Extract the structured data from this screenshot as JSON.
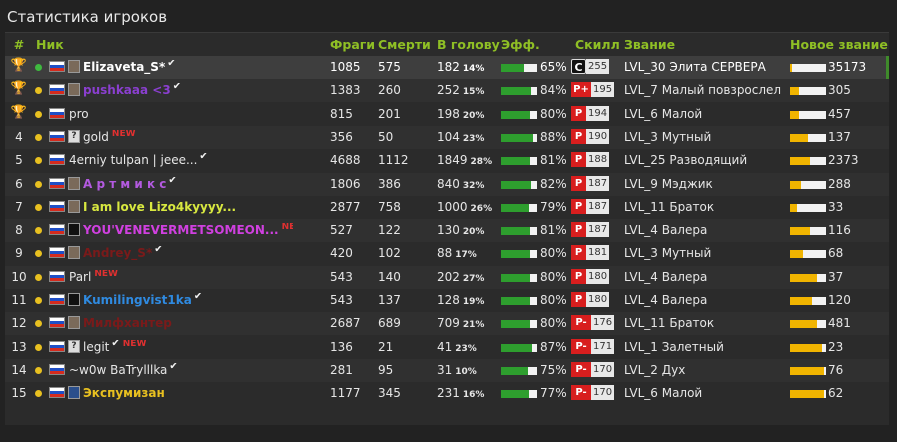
{
  "title": "Статистика игроков",
  "colors": {
    "header": "#8fbf25",
    "accent_green": "#2e9e2e",
    "rank_yellow": "#f0b400",
    "skill_red": "#d81e1e"
  },
  "headers": {
    "num": "#",
    "nick": "Ник",
    "frags": "Фраги",
    "deaths": "Смерти",
    "headshots": "В голову",
    "eff": "Эфф.",
    "skill": "Скилл",
    "rank": "Звание",
    "new_rank": "Новое звание"
  },
  "rows": [
    {
      "num": "",
      "trophy": "gold",
      "dot": "#3fb93f",
      "avatar": "photo",
      "nick": "Elizaveta_S*",
      "nick_color": "#ffffff",
      "verified": true,
      "new": "",
      "frags": "1085",
      "deaths": "575",
      "hs": "182",
      "hs_pct": "14%",
      "eff": 0.65,
      "eff_label": "65%",
      "skill_grade": "C",
      "skill": "255",
      "rank": "LVL_30 Элита СЕРВЕРА",
      "new_rank": 0.05,
      "new_rank_value": "35173"
    },
    {
      "num": "",
      "trophy": "silver",
      "dot": "#e8c020",
      "avatar": "photo",
      "nick": "pushkaaa <3",
      "nick_color": "#8a3fcf",
      "verified": true,
      "new": "",
      "frags": "1383",
      "deaths": "260",
      "hs": "252",
      "hs_pct": "15%",
      "eff": 0.84,
      "eff_label": "84%",
      "skill_grade": "P+",
      "skill": "195",
      "rank": "LVL_7 Малый повзрослел",
      "new_rank": 0.25,
      "new_rank_value": "305"
    },
    {
      "num": "",
      "trophy": "bronze",
      "dot": "#e8c020",
      "avatar": "none",
      "nick": "pro",
      "nick_color": "#e6e6e6",
      "verified": false,
      "new": "",
      "frags": "815",
      "deaths": "201",
      "hs": "198",
      "hs_pct": "20%",
      "eff": 0.8,
      "eff_label": "80%",
      "skill_grade": "P",
      "skill": "194",
      "rank": "LVL_6 Малой",
      "new_rank": 0.25,
      "new_rank_value": "457"
    },
    {
      "num": "4",
      "trophy": "",
      "dot": "#e8c020",
      "avatar": "q",
      "nick": "gold",
      "nick_color": "#e6e6e6",
      "verified": false,
      "new": "NEW",
      "frags": "356",
      "deaths": "50",
      "hs": "104",
      "hs_pct": "23%",
      "eff": 0.88,
      "eff_label": "88%",
      "skill_grade": "P",
      "skill": "190",
      "rank": "LVL_3 Мутный",
      "new_rank": 0.5,
      "new_rank_value": "137"
    },
    {
      "num": "5",
      "trophy": "",
      "dot": "#e8c020",
      "avatar": "none",
      "nick": "4erniy tulpan | jeee...",
      "nick_color": "#e6e6e6",
      "verified": true,
      "new": "",
      "frags": "4688",
      "deaths": "1112",
      "hs": "1849",
      "hs_pct": "28%",
      "eff": 0.81,
      "eff_label": "81%",
      "skill_grade": "P",
      "skill": "188",
      "rank": "LVL_25 Разводящий",
      "new_rank": 0.55,
      "new_rank_value": "2373"
    },
    {
      "num": "6",
      "trophy": "",
      "dot": "#e8c020",
      "avatar": "photo",
      "nick": "А р т м и к с",
      "nick_color": "#b35ae0",
      "verified": true,
      "new": "",
      "frags": "1806",
      "deaths": "386",
      "hs": "840",
      "hs_pct": "32%",
      "eff": 0.82,
      "eff_label": "82%",
      "skill_grade": "P",
      "skill": "187",
      "rank": "LVL_9 Мэджик",
      "new_rank": 0.3,
      "new_rank_value": "288"
    },
    {
      "num": "7",
      "trophy": "",
      "dot": "#e8c020",
      "avatar": "photo",
      "nick": "I am love Lizo4kyyyy...",
      "nick_color": "#d8e840",
      "verified": false,
      "new": "",
      "frags": "2877",
      "deaths": "758",
      "hs": "1000",
      "hs_pct": "26%",
      "eff": 0.79,
      "eff_label": "79%",
      "skill_grade": "P",
      "skill": "187",
      "rank": "LVL_11 Браток",
      "new_rank": 0.2,
      "new_rank_value": "33"
    },
    {
      "num": "8",
      "trophy": "",
      "dot": "#e8c020",
      "avatar": "dark",
      "nick": "YOU'VENEVERMETSOMEON...",
      "nick_color": "#d040e0",
      "verified": false,
      "new": "NEW",
      "frags": "527",
      "deaths": "122",
      "hs": "130",
      "hs_pct": "20%",
      "eff": 0.81,
      "eff_label": "81%",
      "skill_grade": "P",
      "skill": "187",
      "rank": "LVL_4 Валера",
      "new_rank": 0.55,
      "new_rank_value": "116"
    },
    {
      "num": "9",
      "trophy": "",
      "dot": "#e8c020",
      "avatar": "photo",
      "nick": "Andrey_S*",
      "nick_color": "#7a1a1a",
      "verified": true,
      "new": "",
      "frags": "420",
      "deaths": "102",
      "hs": "88",
      "hs_pct": "17%",
      "eff": 0.8,
      "eff_label": "80%",
      "skill_grade": "P",
      "skill": "181",
      "rank": "LVL_3 Мутный",
      "new_rank": 0.35,
      "new_rank_value": "68"
    },
    {
      "num": "10",
      "trophy": "",
      "dot": "#e8c020",
      "avatar": "none",
      "nick": "Parl",
      "nick_color": "#e6e6e6",
      "verified": false,
      "new": "NEW",
      "frags": "543",
      "deaths": "140",
      "hs": "202",
      "hs_pct": "27%",
      "eff": 0.8,
      "eff_label": "80%",
      "skill_grade": "P",
      "skill": "180",
      "rank": "LVL_4 Валера",
      "new_rank": 0.75,
      "new_rank_value": "37"
    },
    {
      "num": "11",
      "trophy": "",
      "dot": "#e8c020",
      "avatar": "dark",
      "nick": "Kumilingvist1ka",
      "nick_color": "#2f8ae0",
      "verified": true,
      "new": "",
      "frags": "543",
      "deaths": "137",
      "hs": "128",
      "hs_pct": "19%",
      "eff": 0.8,
      "eff_label": "80%",
      "skill_grade": "P",
      "skill": "180",
      "rank": "LVL_4 Валера",
      "new_rank": 0.6,
      "new_rank_value": "120"
    },
    {
      "num": "12",
      "trophy": "",
      "dot": "#e8c020",
      "avatar": "photo",
      "nick": "Милфхантер",
      "nick_color": "#7a1a1a",
      "verified": false,
      "new": "",
      "frags": "2687",
      "deaths": "689",
      "hs": "709",
      "hs_pct": "21%",
      "eff": 0.8,
      "eff_label": "80%",
      "skill_grade": "P-",
      "skill": "176",
      "rank": "LVL_11 Браток",
      "new_rank": 0.75,
      "new_rank_value": "481"
    },
    {
      "num": "13",
      "trophy": "",
      "dot": "#e8c020",
      "avatar": "q",
      "nick": "legit",
      "nick_color": "#e6e6e6",
      "verified": true,
      "new": "NEW",
      "frags": "136",
      "deaths": "21",
      "hs": "41",
      "hs_pct": "23%",
      "eff": 0.87,
      "eff_label": "87%",
      "skill_grade": "P-",
      "skill": "171",
      "rank": "LVL_1 Залетный",
      "new_rank": 0.9,
      "new_rank_value": "23"
    },
    {
      "num": "14",
      "trophy": "",
      "dot": "#e8c020",
      "avatar": "none",
      "nick": "~w0w BaTrylllka",
      "nick_color": "#e6e6e6",
      "verified": true,
      "new": "",
      "frags": "281",
      "deaths": "95",
      "hs": "31",
      "hs_pct": "10%",
      "eff": 0.75,
      "eff_label": "75%",
      "skill_grade": "P-",
      "skill": "170",
      "rank": "LVL_2 Дух",
      "new_rank": 0.95,
      "new_rank_value": "76"
    },
    {
      "num": "15",
      "trophy": "",
      "dot": "#e8c020",
      "avatar": "alien",
      "nick": "Экспумизан",
      "nick_color": "#e8c020",
      "verified": false,
      "new": "",
      "frags": "1177",
      "deaths": "345",
      "hs": "231",
      "hs_pct": "16%",
      "eff": 0.77,
      "eff_label": "77%",
      "skill_grade": "P-",
      "skill": "170",
      "rank": "LVL_6 Малой",
      "new_rank": 0.95,
      "new_rank_value": "62"
    }
  ]
}
